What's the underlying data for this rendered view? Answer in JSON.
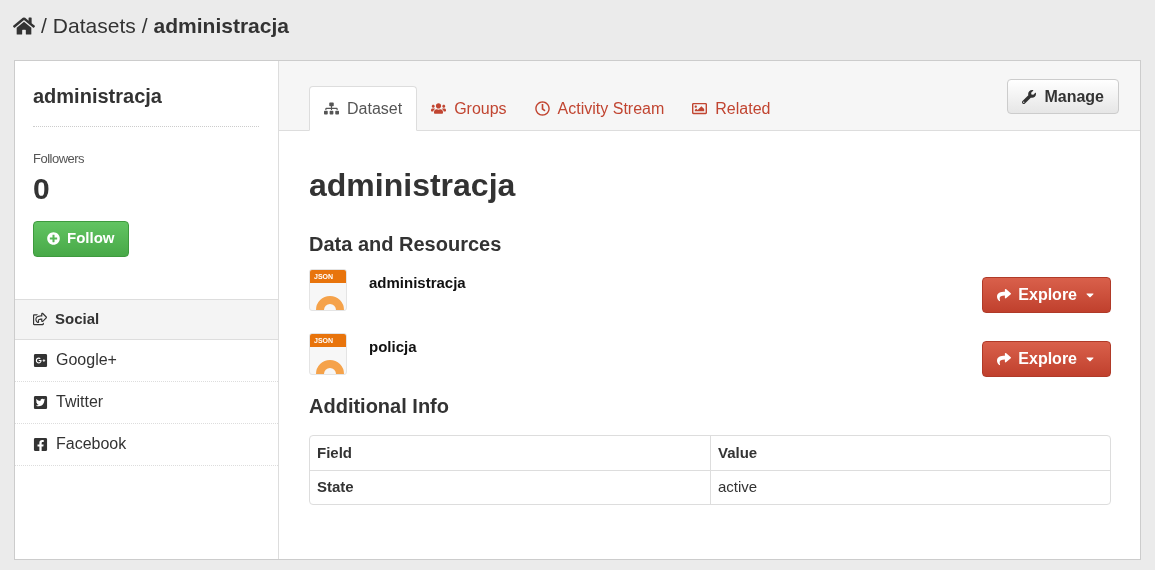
{
  "breadcrumb_separator": "/",
  "breadcrumb": [
    {
      "kind": "home"
    },
    {
      "kind": "link",
      "label": "Datasets"
    },
    {
      "kind": "current",
      "label": "administracja"
    }
  ],
  "sidebar": {
    "title": "administracja",
    "followers_label": "Followers",
    "followers_count": "0",
    "follow_button": "Follow",
    "social": {
      "heading": "Social",
      "items": [
        {
          "kind": "google",
          "label": "Google+"
        },
        {
          "kind": "twitter",
          "label": "Twitter"
        },
        {
          "kind": "facebook",
          "label": "Facebook"
        }
      ]
    }
  },
  "tabs": [
    {
      "kind": "dataset",
      "label": "Dataset",
      "selected": true
    },
    {
      "kind": "groups",
      "label": "Groups",
      "selected": false
    },
    {
      "kind": "activity",
      "label": "Activity Stream",
      "selected": false
    },
    {
      "kind": "related",
      "label": "Related",
      "selected": false
    }
  ],
  "manage_button": "Manage",
  "title": "administracja",
  "resources_heading": "Data and Resources",
  "resources": [
    {
      "format": "JSON",
      "name": "administracja",
      "button": "Explore"
    },
    {
      "format": "JSON",
      "name": "policja",
      "button": "Explore"
    }
  ],
  "additional_heading": "Additional Info",
  "table": {
    "columns": [
      "Field",
      "Value"
    ],
    "rows": [
      [
        "State",
        "active"
      ]
    ]
  }
}
